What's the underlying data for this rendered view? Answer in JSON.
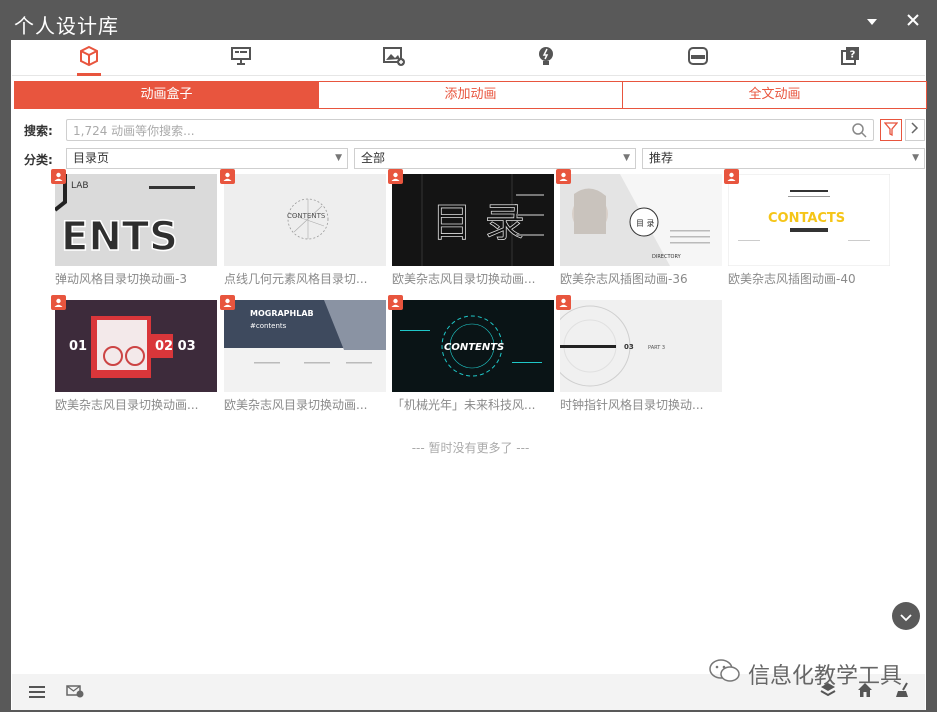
{
  "window": {
    "title": "个人设计库"
  },
  "icon_tabs": [
    {
      "icon": "cube-icon",
      "active": true
    },
    {
      "icon": "presentation-icon",
      "active": false
    },
    {
      "icon": "image-add-icon",
      "active": false
    },
    {
      "icon": "bulb-icon",
      "active": false
    },
    {
      "icon": "storage-icon",
      "active": false
    },
    {
      "icon": "help-icon",
      "active": false
    }
  ],
  "sub_tabs": [
    {
      "label": "动画盒子",
      "active": true
    },
    {
      "label": "添加动画",
      "active": false
    },
    {
      "label": "全文动画",
      "active": false
    }
  ],
  "search": {
    "label": "搜索:",
    "placeholder": "1,724 动画等你搜索..."
  },
  "filters": {
    "label": "分类:",
    "category": "目录页",
    "scope": "全部",
    "sort": "推荐"
  },
  "items": [
    {
      "caption": "弹动风格目录切换动画-3",
      "thumb_text": "ENTS",
      "thumb_sub": "LAB"
    },
    {
      "caption": "点线几何元素风格目录切...",
      "thumb_text": "CONTENTS",
      "thumb_sub": ""
    },
    {
      "caption": "欧美杂志风目录切换动画...",
      "thumb_text": "目 录",
      "thumb_sub": ""
    },
    {
      "caption": "欧美杂志风插图动画-36",
      "thumb_text": "目 录",
      "thumb_sub": "DIRECTORY"
    },
    {
      "caption": "欧美杂志风插图动画-40",
      "thumb_text": "CONTACTS",
      "thumb_sub": ""
    },
    {
      "caption": "欧美杂志风目录切换动画...",
      "thumb_text": "01",
      "thumb_sub": "02 03"
    },
    {
      "caption": "欧美杂志风目录切换动画...",
      "thumb_text": "MOGRAPHLAB",
      "thumb_sub": "#contents"
    },
    {
      "caption": "「机械光年」未来科技风...",
      "thumb_text": "CONTENTS",
      "thumb_sub": ""
    },
    {
      "caption": "时钟指针风格目录切换动...",
      "thumb_text": "PART 3",
      "thumb_sub": "03"
    }
  ],
  "no_more": "--- 暂时没有更多了 ---",
  "watermark": "信息化教学工具",
  "colors": {
    "accent": "#e8553e",
    "titlebar": "#595959"
  }
}
